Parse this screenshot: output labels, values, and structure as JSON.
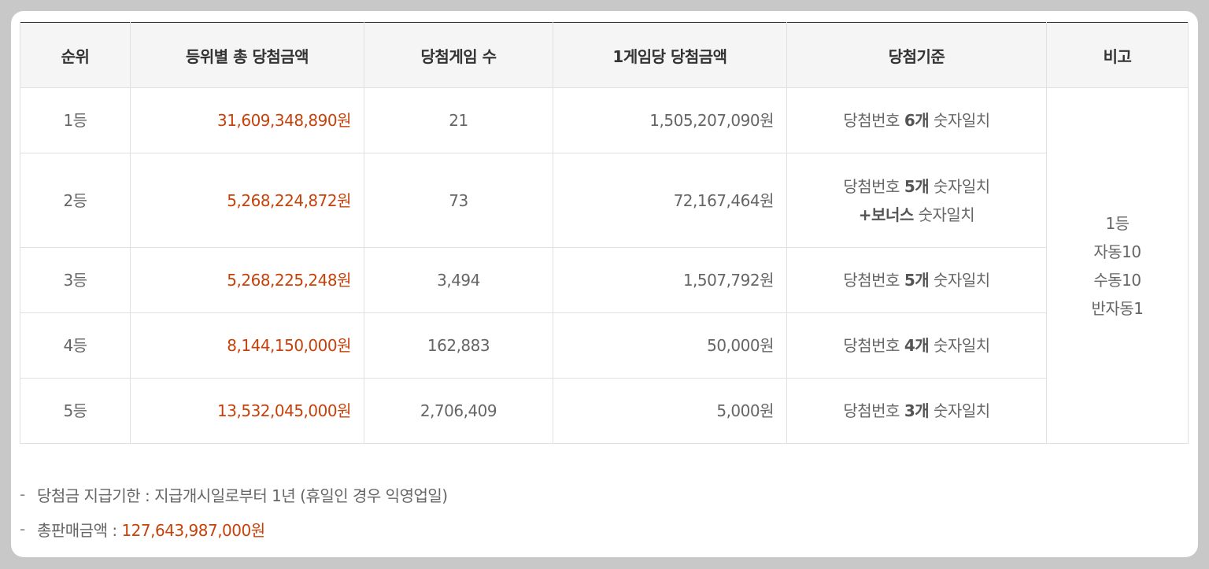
{
  "headers": [
    "순위",
    "등위별 총 당첨금액",
    "당첨게임 수",
    "1게임당 당첨금액",
    "당첨기준",
    "비고"
  ],
  "rows": [
    {
      "rank": "1등",
      "total": "31,609,348,890원",
      "count": "21",
      "per_game": "1,505,207,090원",
      "crit_a": "당첨번호 ",
      "crit_b": "6개",
      "crit_c": " 숫자일치"
    },
    {
      "rank": "2등",
      "total": "5,268,224,872원",
      "count": "73",
      "per_game": "72,167,464원",
      "crit_a": "당첨번호 ",
      "crit_b": "5개",
      "crit_c": " 숫자일치",
      "crit2_b": "+보너스",
      "crit2_c": " 숫자일치"
    },
    {
      "rank": "3등",
      "total": "5,268,225,248원",
      "count": "3,494",
      "per_game": "1,507,792원",
      "crit_a": "당첨번호 ",
      "crit_b": "5개",
      "crit_c": " 숫자일치"
    },
    {
      "rank": "4등",
      "total": "8,144,150,000원",
      "count": "162,883",
      "per_game": "50,000원",
      "crit_a": "당첨번호 ",
      "crit_b": "4개",
      "crit_c": " 숫자일치"
    },
    {
      "rank": "5등",
      "total": "13,532,045,000원",
      "count": "2,706,409",
      "per_game": "5,000원",
      "crit_a": "당첨번호 ",
      "crit_b": "3개",
      "crit_c": " 숫자일치"
    }
  ],
  "remark": [
    "1등",
    "자동10",
    "수동10",
    "반자동1"
  ],
  "notes": {
    "dash": "-",
    "deadline_label": "당첨금 지급기한 : 지급개시일로부터 1년 (휴일인 경우 익영업일)",
    "sales_label": "총판매금액 : ",
    "sales_value": "127,643,987,000원"
  },
  "colors": {
    "accent_red": "#c7420a",
    "header_bg": "#f5f5f5",
    "border": "#e0e0e0"
  }
}
